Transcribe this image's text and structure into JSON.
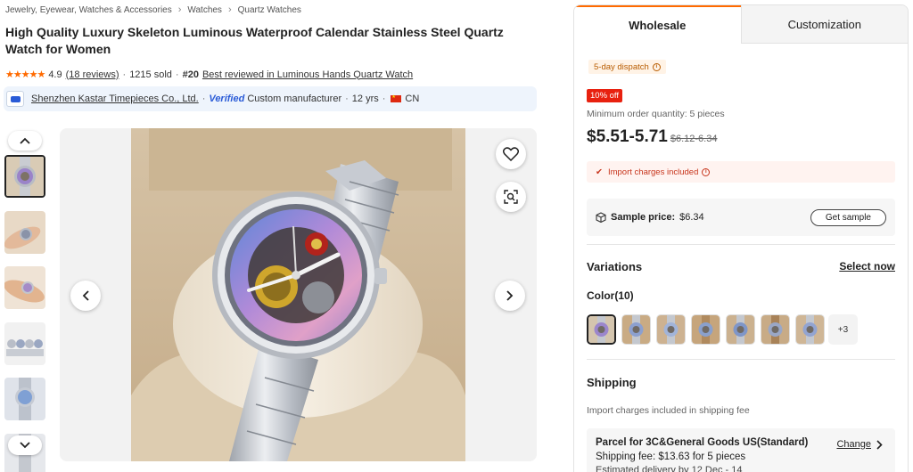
{
  "breadcrumb": {
    "items": [
      "Jewelry, Eyewear, Watches & Accessories",
      "Watches",
      "Quartz Watches"
    ],
    "separator": "›"
  },
  "product": {
    "title": "High Quality Luxury Skeleton Luminous Waterproof Calendar Stainless Steel Quartz Watch for Women",
    "rating": "4.9",
    "rating_stars": 5,
    "reviews": "(18 reviews)",
    "sold": "1215 sold",
    "rank": "#20",
    "rank_label": "Best reviewed in Luminous Hands Quartz Watch"
  },
  "supplier": {
    "name": "Shenzhen Kastar Timepieces Co., Ltd.",
    "verified": "Verified",
    "type": "Custom manufacturer",
    "years": "12 yrs",
    "country": "CN"
  },
  "gallery": {
    "thumbnail_count": 6,
    "active_thumbnail": 0
  },
  "tabs": [
    "Wholesale",
    "Customization"
  ],
  "offer": {
    "dispatch": "5-day dispatch",
    "discount": "10% off",
    "moq": "Minimum order quantity: 5 pieces",
    "price": "$5.51-5.71",
    "old_price": "$6.12-6.34",
    "import_note": "Import charges included",
    "sample_label": "Sample price:",
    "sample_price": "$6.34",
    "get_sample": "Get sample"
  },
  "variations": {
    "title": "Variations",
    "select_now": "Select now",
    "color_label": "Color(10)",
    "more": "+3"
  },
  "shipping": {
    "title": "Shipping",
    "note": "Import charges included in shipping fee",
    "method": "Parcel for 3C&General Goods US(Standard)",
    "change": "Change",
    "fee": "Shipping fee: $13.63 for 5 pieces",
    "delivery": "Estimated delivery by 12 Dec - 14"
  },
  "colors": {
    "accent": "#ff6a00",
    "discount": "#e8210f",
    "verified": "#2a5bd7"
  }
}
